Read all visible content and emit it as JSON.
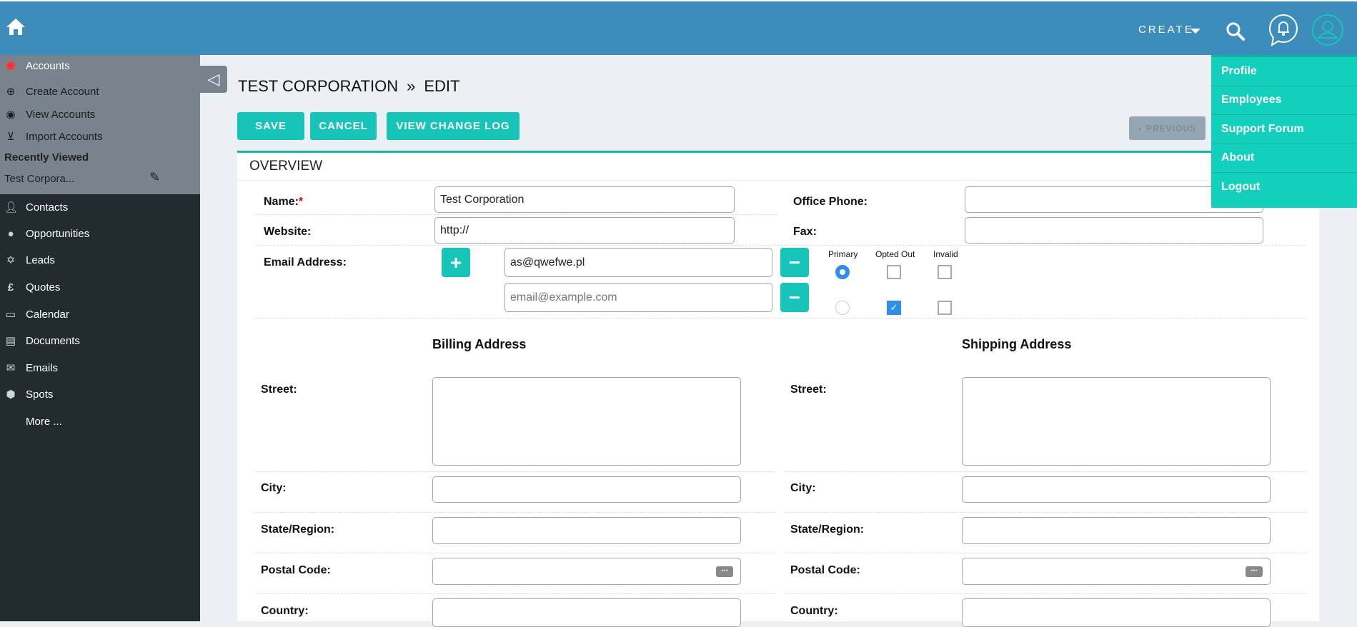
{
  "header": {
    "create_label": "CREATE",
    "icons": [
      "home-icon",
      "caret-down-icon",
      "search-icon",
      "notification-bell-icon",
      "user-avatar-icon"
    ]
  },
  "sidebar": {
    "module": "Accounts",
    "actions": [
      {
        "label": "Create Account",
        "icon": "plus-circle-icon"
      },
      {
        "label": "View Accounts",
        "icon": "eye-icon"
      },
      {
        "label": "Import Accounts",
        "icon": "download-icon"
      }
    ],
    "recently_viewed_title": "Recently Viewed",
    "recent": "Test Corpora...",
    "items": [
      {
        "label": "Contacts",
        "icon": "person-icon"
      },
      {
        "label": "Opportunities",
        "icon": "lightbulb-icon"
      },
      {
        "label": "Leads",
        "icon": "star-icon"
      },
      {
        "label": "Quotes",
        "icon": "pound-icon"
      },
      {
        "label": "Calendar",
        "icon": "calendar-icon"
      },
      {
        "label": "Documents",
        "icon": "documents-icon"
      },
      {
        "label": "Emails",
        "icon": "envelope-icon"
      },
      {
        "label": "Spots",
        "icon": "cube-icon"
      }
    ],
    "more": "More ..."
  },
  "page": {
    "record": "TEST CORPORATION",
    "sep": "»",
    "mode": "EDIT"
  },
  "toolbar": {
    "save": "SAVE",
    "cancel": "CANCEL",
    "changelog": "VIEW CHANGE LOG",
    "previous": "PREVIOUS"
  },
  "panel": {
    "title": "OVERVIEW"
  },
  "form": {
    "name_label": "Name:",
    "required": "*",
    "name_value": "Test Corporation",
    "website_label": "Website:",
    "website_value": "http://",
    "phone_label": "Office Phone:",
    "phone_value": "",
    "fax_label": "Fax:",
    "fax_value": "",
    "email_label": "Email Address:",
    "email_cols": [
      "Primary",
      "Opted Out",
      "Invalid"
    ],
    "emails": [
      {
        "value": "as@qwefwe.pl",
        "primary": true,
        "opted_out": false,
        "invalid": false
      },
      {
        "value": "",
        "placeholder": "email@example.com",
        "primary": false,
        "opted_out": true,
        "invalid": false
      }
    ],
    "billing_title": "Billing Address",
    "shipping_title": "Shipping Address",
    "street": "Street:",
    "city": "City:",
    "state": "State/Region:",
    "postal": "Postal Code:",
    "country": "Country:"
  },
  "user_menu": [
    "Profile",
    "Employees",
    "Support Forum",
    "About",
    "Logout"
  ],
  "colors": {
    "header": "#3c8dbc",
    "accent": "#17c5b8",
    "menu": "#13d0bd",
    "sidebar": "#222b30"
  }
}
